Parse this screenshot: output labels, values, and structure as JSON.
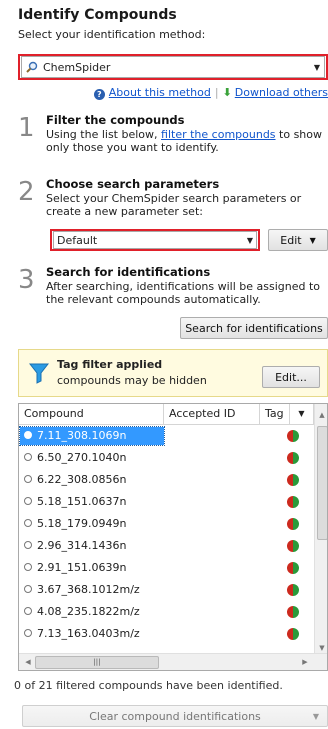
{
  "header": {
    "title": "Identify Compounds",
    "subtitle": "Select your identification method:"
  },
  "method": {
    "selected": "ChemSpider",
    "about_link": "About this method",
    "download_link": "Download others"
  },
  "steps": [
    {
      "number": "1",
      "heading": "Filter the compounds",
      "desc_before": "Using the list below, ",
      "desc_link": "filter the compounds",
      "desc_after": " to show only those you want to identify."
    },
    {
      "number": "2",
      "heading": "Choose search parameters",
      "desc": "Select your ChemSpider search parameters or create a new parameter set:"
    },
    {
      "number": "3",
      "heading": "Search for identifications",
      "desc": "After searching, identifications will be assigned to the relevant compounds automatically."
    }
  ],
  "params": {
    "selected": "Default",
    "edit_label": "Edit"
  },
  "search_button": "Search for identifications",
  "tag_filter": {
    "title": "Tag filter applied",
    "subtitle": "compounds may be hidden",
    "edit_label": "Edit..."
  },
  "table": {
    "columns": [
      "Compound",
      "Accepted ID",
      "Tag"
    ],
    "rows": [
      {
        "compound": "7.11_308.1069n",
        "accepted_id": "",
        "selected": true
      },
      {
        "compound": "6.50_270.1040n",
        "accepted_id": "",
        "selected": false
      },
      {
        "compound": "6.22_308.0856n",
        "accepted_id": "",
        "selected": false
      },
      {
        "compound": "5.18_151.0637n",
        "accepted_id": "",
        "selected": false
      },
      {
        "compound": "5.18_179.0949n",
        "accepted_id": "",
        "selected": false
      },
      {
        "compound": "2.96_314.1436n",
        "accepted_id": "",
        "selected": false
      },
      {
        "compound": "2.91_151.0639n",
        "accepted_id": "",
        "selected": false
      },
      {
        "compound": "3.67_368.1012m/z",
        "accepted_id": "",
        "selected": false
      },
      {
        "compound": "4.08_235.1822m/z",
        "accepted_id": "",
        "selected": false
      },
      {
        "compound": "7.13_163.0403m/z",
        "accepted_id": "",
        "selected": false
      }
    ]
  },
  "status": "0 of 21 filtered compounds have been identified.",
  "clear_button": "Clear compound identifications",
  "colors": {
    "highlight_border": "#e0202a",
    "link": "#1155cc",
    "selection": "#3399ff",
    "tag_box_bg": "#fffbe0"
  }
}
